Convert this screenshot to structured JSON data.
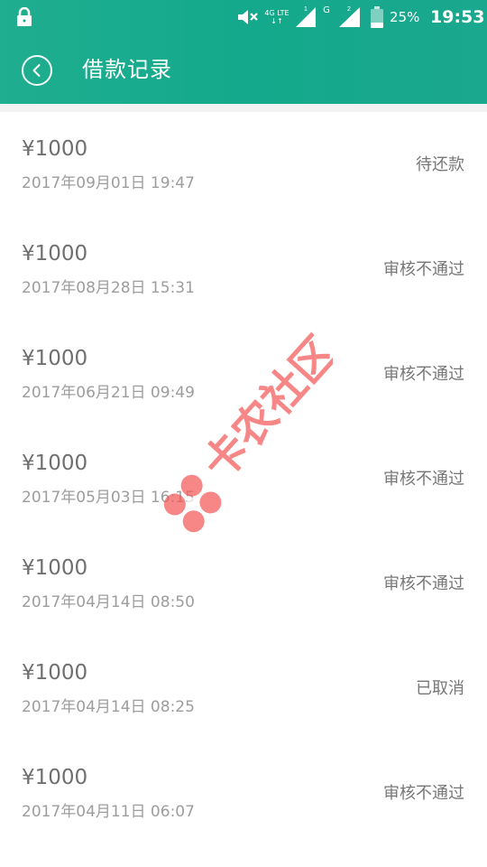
{
  "status_bar": {
    "network_label": "4G LTE",
    "sim1": "1",
    "sim2_type": "G",
    "sim2": "2",
    "battery": "25%",
    "time": "19:53"
  },
  "header": {
    "title": "借款记录",
    "back_icon": "chevron-left-circle-icon"
  },
  "records": [
    {
      "amount": "¥1000",
      "datetime": "2017年09月01日 19:47",
      "status": "待还款"
    },
    {
      "amount": "¥1000",
      "datetime": "2017年08月28日 15:31",
      "status": "审核不通过"
    },
    {
      "amount": "¥1000",
      "datetime": "2017年06月21日 09:49",
      "status": "审核不通过"
    },
    {
      "amount": "¥1000",
      "datetime": "2017年05月03日 16:15",
      "status": "审核不通过"
    },
    {
      "amount": "¥1000",
      "datetime": "2017年04月14日 08:50",
      "status": "审核不通过"
    },
    {
      "amount": "¥1000",
      "datetime": "2017年04月14日 08:25",
      "status": "已取消"
    },
    {
      "amount": "¥1000",
      "datetime": "2017年04月11日 06:07",
      "status": "审核不通过"
    }
  ],
  "watermark": {
    "text": "卡农社区"
  },
  "colors": {
    "header": "#14a98c",
    "watermark": "#f45a5a"
  }
}
